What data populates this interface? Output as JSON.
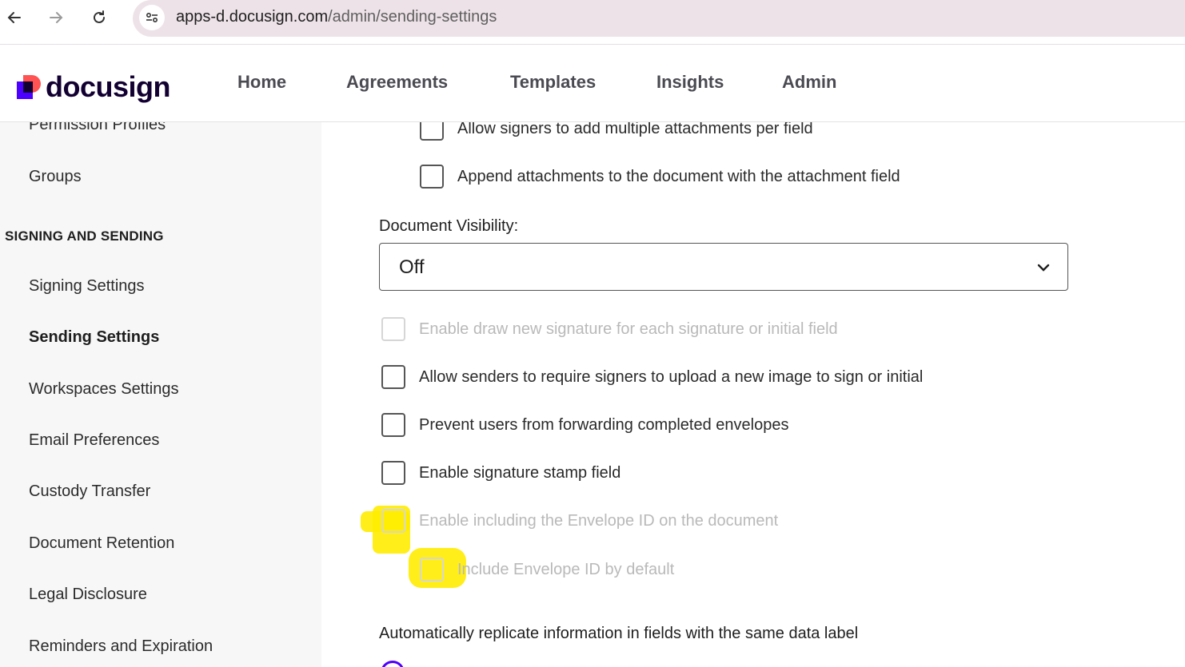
{
  "browser": {
    "url_host": "apps-d.docusign.com",
    "url_path": "/admin/sending-settings"
  },
  "header": {
    "logo_text": "docusign",
    "nav": [
      "Home",
      "Agreements",
      "Templates",
      "Insights",
      "Admin"
    ]
  },
  "sidebar": {
    "items_top": [
      "Permission Profiles",
      "Groups"
    ],
    "section_title": "SIGNING AND SENDING",
    "items": [
      "Signing Settings",
      "Sending Settings",
      "Workspaces Settings",
      "Email Preferences",
      "Custody Transfer",
      "Document Retention",
      "Legal Disclosure",
      "Reminders and Expiration"
    ],
    "active": "Sending Settings"
  },
  "main": {
    "attachments": [
      "Allow signers to add multiple attachments per field",
      "Append attachments to the document with the attachment field"
    ],
    "document_visibility_label": "Document Visibility:",
    "document_visibility_value": "Off",
    "options": [
      "Enable draw new signature for each signature or initial field",
      "Allow senders to require signers to upload a new image to sign or initial",
      "Prevent users from forwarding completed envelopes",
      "Enable signature stamp field",
      "Enable including the Envelope ID on the document"
    ],
    "sub_option": "Include Envelope ID by default",
    "replicate_label": "Automatically replicate information in fields with the same data label"
  },
  "colors": {
    "accent": "#4c00ff",
    "logo_coral": "#ff5252",
    "highlight": "#ffec00",
    "sidebar_bg": "#f7f7f7"
  }
}
